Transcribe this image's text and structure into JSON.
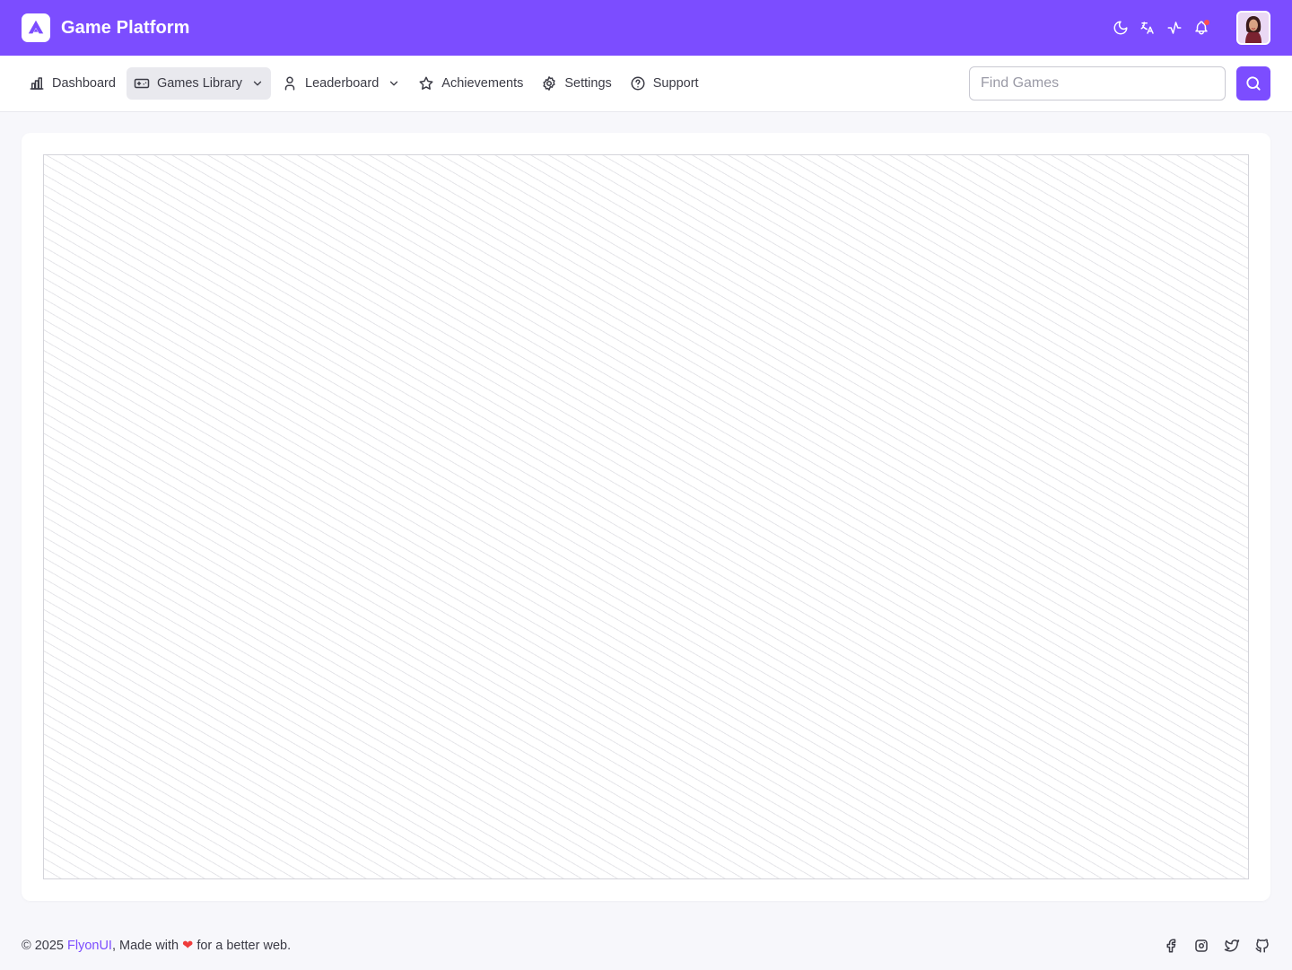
{
  "header": {
    "brand": "Game Platform",
    "icons": [
      "moon-icon",
      "translate-icon",
      "activity-icon",
      "bell-icon"
    ],
    "accent_color": "#7c4dff",
    "notification_dot_color": "#ff4d4f"
  },
  "nav": {
    "items": [
      {
        "label": "Dashboard",
        "icon": "bar-chart-icon"
      },
      {
        "label": "Games Library",
        "icon": "gamepad-icon",
        "dropdown": true,
        "active": true
      },
      {
        "label": "Leaderboard",
        "icon": "user-icon",
        "dropdown": true
      },
      {
        "label": "Achievements",
        "icon": "star-icon"
      },
      {
        "label": "Settings",
        "icon": "gear-icon"
      },
      {
        "label": "Support",
        "icon": "help-circle-icon"
      }
    ],
    "search": {
      "placeholder": "Find Games",
      "value": ""
    }
  },
  "footer": {
    "prefix": "© 2025 ",
    "link": "FlyonUI",
    "middle": ", Made with ",
    "heart": "❤",
    "suffix": " for a better web.",
    "socials": [
      "facebook-icon",
      "instagram-icon",
      "twitter-icon",
      "github-icon"
    ]
  }
}
